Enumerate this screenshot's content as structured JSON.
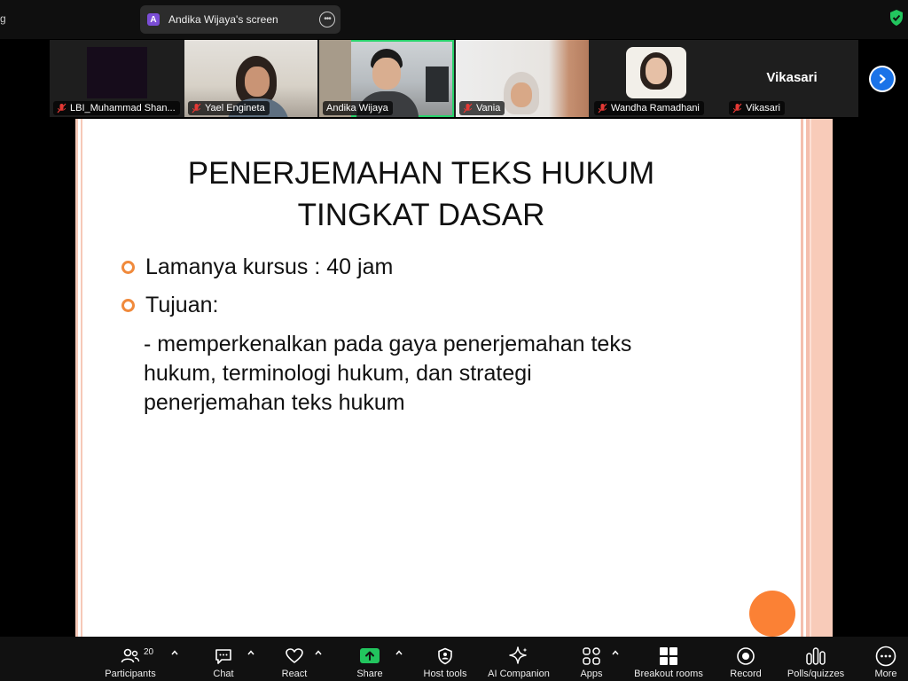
{
  "topbar": {
    "left_glyph": "g",
    "share_badge": "A",
    "share_label": "Andika Wijaya's screen",
    "more_label": "•••"
  },
  "participants": [
    {
      "name": "LBI_Muhammad Shan...",
      "muted": true
    },
    {
      "name": "Yael Engineta",
      "muted": true
    },
    {
      "name": "Andika Wijaya",
      "muted": false,
      "active": true
    },
    {
      "name": "Vania",
      "muted": true
    },
    {
      "name": "Wandha Ramadhani",
      "muted": true
    },
    {
      "name": "Vikasari",
      "muted": true,
      "display_name": "Vikasari"
    }
  ],
  "slide": {
    "title_line1": "PENERJEMAHAN TEKS HUKUM",
    "title_line2": "TINGKAT DASAR",
    "bullet1": "Lamanya kursus : 40 jam",
    "bullet2": "Tujuan:",
    "body_line1": "- memperkenalkan pada gaya penerjemahan teks",
    "body_line2": "hukum, terminologi hukum, dan strategi",
    "body_line3": "penerjemahan teks hukum"
  },
  "toolbar": {
    "participants_label": "Participants",
    "participants_count": "20",
    "chat_label": "Chat",
    "react_label": "React",
    "share_label": "Share",
    "host_tools_label": "Host tools",
    "ai_label": "AI Companion",
    "apps_label": "Apps",
    "breakout_label": "Breakout rooms",
    "record_label": "Record",
    "polls_label": "Polls/quizzes",
    "more_label": "More"
  },
  "colors": {
    "share_green": "#22c55e",
    "active_outline": "#28d26b",
    "bullet_orange": "#f08a3c",
    "next_blue": "#1a73e8"
  }
}
